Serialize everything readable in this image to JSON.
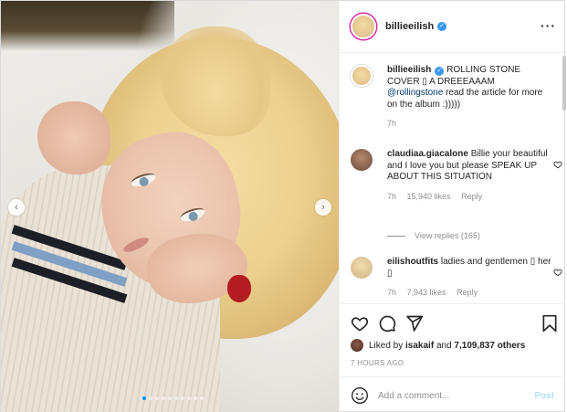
{
  "post": {
    "username": "billieeilish",
    "verified": true,
    "more_icon": "more-horizontal-icon",
    "carousel": {
      "prev_icon": "chevron-left-icon",
      "next_icon": "chevron-right-icon",
      "slide_count": 10,
      "active_slide": 1
    }
  },
  "caption": {
    "username": "billieeilish",
    "text_before": " ROLLING STONE COVER ",
    "box": "▯",
    "text_mid": " A DREEEAAAM ",
    "mention": "@rollingstone",
    "text_after": " read the article for more on the album :)))))",
    "time": "7h"
  },
  "comments": [
    {
      "username": "claudiaa.giacalone",
      "text": " Billie your beautiful and I love you but please SPEAK UP ABOUT THIS SITUATION",
      "time": "7h",
      "likes": "15,940 likes",
      "reply": "Reply",
      "view_replies": "View replies (165)"
    },
    {
      "username": "eilishoutfits",
      "text": " ladies and gentlemen ▯ her ▯",
      "time": "7h",
      "likes": "7,943 likes",
      "reply": "Reply"
    }
  ],
  "actions": {
    "like_icon": "heart-icon",
    "comment_icon": "comment-icon",
    "share_icon": "share-icon",
    "save_icon": "bookmark-icon"
  },
  "likes": {
    "prefix": "Liked by ",
    "user": "isakaif",
    "connector": " and ",
    "count": "7,109,837 others"
  },
  "timestamp": "7 HOURS AGO",
  "add_comment": {
    "placeholder": "Add a comment...",
    "post_label": "Post",
    "emoji_icon": "smile-icon"
  },
  "colors": {
    "verified": "#3897f0",
    "link": "#00376b",
    "post_disabled": "#b2dffc",
    "story_ring": "#d6249f"
  }
}
